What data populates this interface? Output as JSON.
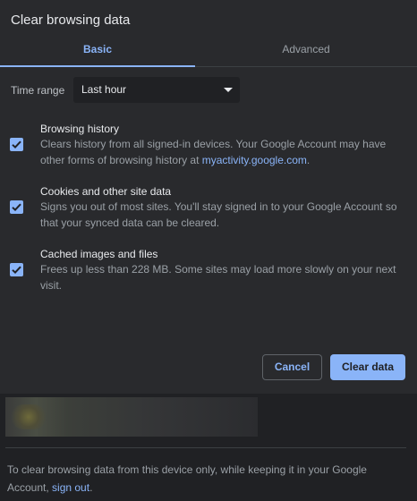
{
  "dialog": {
    "title": "Clear browsing data",
    "tabs": [
      {
        "label": "Basic"
      },
      {
        "label": "Advanced"
      }
    ],
    "time_range": {
      "label": "Time range",
      "value": "Last hour"
    },
    "options": [
      {
        "title": "Browsing history",
        "checked": true,
        "desc_before": "Clears history from all signed-in devices. Your Google Account may have other forms of browsing history at ",
        "link": "myactivity.google.com",
        "desc_after": "."
      },
      {
        "title": "Cookies and other site data",
        "checked": true,
        "desc": "Signs you out of most sites. You'll stay signed in to your Google Account so that your synced data can be cleared."
      },
      {
        "title": "Cached images and files",
        "checked": true,
        "desc": "Frees up less than 228 MB. Some sites may load more slowly on your next visit."
      }
    ],
    "buttons": {
      "cancel": "Cancel",
      "clear": "Clear data"
    }
  },
  "footer": {
    "text_before": "To clear browsing data from this device only, while keeping it in your Google Account, ",
    "link": "sign out",
    "text_after": "."
  },
  "colors": {
    "accent": "#8ab4f8",
    "dialog_bg": "#292a2d",
    "page_bg": "#202124"
  }
}
